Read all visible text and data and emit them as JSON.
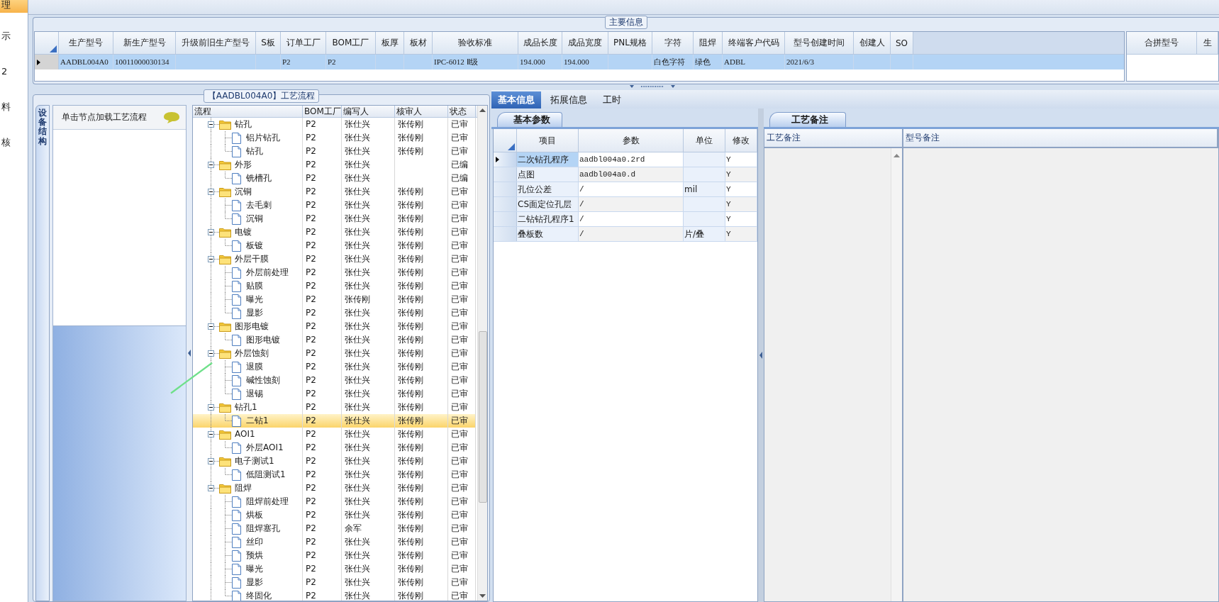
{
  "nav_strip": {
    "items": [
      {
        "label": "理",
        "selected": true
      },
      {
        "label": "示",
        "selected": false
      },
      {
        "label": "2",
        "selected": false
      },
      {
        "label": "料",
        "selected": false
      },
      {
        "label": "核",
        "selected": false
      }
    ]
  },
  "main_info": {
    "title": "主要信息",
    "columns": [
      "生产型号",
      "新生产型号",
      "升级前旧生产型号",
      "S板",
      "订单工厂",
      "BOM工厂",
      "板厚",
      "板材",
      "验收标准",
      "成品长度",
      "成品宽度",
      "PNL规格",
      "字符",
      "阻焊",
      "终端客户代码",
      "型号创建时间",
      "创建人",
      "SO"
    ],
    "rows": [
      {
        "selected": true,
        "cells": [
          "AADBL004A0",
          "10011000030134",
          null,
          null,
          "P2",
          "P2",
          null,
          null,
          "IPC-6012 Ⅱ级",
          "194.000",
          "194.000",
          null,
          "白色字符",
          "绿色",
          "ADBL",
          "2021/6/3",
          null,
          null
        ]
      }
    ]
  },
  "merge_table": {
    "columns": [
      "合拼型号",
      "生"
    ]
  },
  "process_flow": {
    "title": "【AADBL004A0】工艺流程",
    "side_tab": "设备结构",
    "hint": "单击节点加载工艺流程",
    "columns": [
      "流程",
      "BOM工厂",
      "编写人",
      "核审人",
      "状态"
    ],
    "tree": [
      {
        "name": "钻孔",
        "factory": "P2",
        "writer": "张仕兴",
        "reviewer": "张传刚",
        "status": "已审",
        "expanded": true,
        "selected": false,
        "children": [
          {
            "name": "铝片钻孔",
            "factory": "P2",
            "writer": "张仕兴",
            "reviewer": "张传刚",
            "status": "已审",
            "selected": false
          },
          {
            "name": "钻孔",
            "factory": "P2",
            "writer": "张仕兴",
            "reviewer": "张传刚",
            "status": "已审",
            "selected": false
          }
        ]
      },
      {
        "name": "外形",
        "factory": "P2",
        "writer": "张仕兴",
        "status": "已编",
        "expanded": true,
        "selected": false,
        "children": [
          {
            "name": "铣槽孔",
            "factory": "P2",
            "writer": "张仕兴",
            "status": "已编",
            "selected": false
          }
        ]
      },
      {
        "name": "沉铜",
        "factory": "P2",
        "writer": "张仕兴",
        "reviewer": "张传刚",
        "status": "已审",
        "expanded": true,
        "selected": false,
        "children": [
          {
            "name": "去毛刺",
            "factory": "P2",
            "writer": "张仕兴",
            "reviewer": "张传刚",
            "status": "已审",
            "selected": false
          },
          {
            "name": "沉铜",
            "factory": "P2",
            "writer": "张仕兴",
            "reviewer": "张传刚",
            "status": "已审",
            "selected": false
          }
        ]
      },
      {
        "name": "电镀",
        "factory": "P2",
        "writer": "张仕兴",
        "reviewer": "张传刚",
        "status": "已审",
        "expanded": true,
        "selected": false,
        "children": [
          {
            "name": "板镀",
            "factory": "P2",
            "writer": "张仕兴",
            "reviewer": "张传刚",
            "status": "已审",
            "selected": false
          }
        ]
      },
      {
        "name": "外层干膜",
        "factory": "P2",
        "writer": "张仕兴",
        "reviewer": "张传刚",
        "status": "已审",
        "expanded": true,
        "selected": false,
        "children": [
          {
            "name": "外层前处理",
            "factory": "P2",
            "writer": "张仕兴",
            "reviewer": "张传刚",
            "status": "已审",
            "selected": false
          },
          {
            "name": "贴膜",
            "factory": "P2",
            "writer": "张仕兴",
            "reviewer": "张传刚",
            "status": "已审",
            "selected": false
          },
          {
            "name": "曝光",
            "factory": "P2",
            "writer": "张传刚",
            "reviewer": "张传刚",
            "status": "已审",
            "selected": false
          },
          {
            "name": "显影",
            "factory": "P2",
            "writer": "张仕兴",
            "reviewer": "张传刚",
            "status": "已审",
            "selected": false
          }
        ]
      },
      {
        "name": "图形电镀",
        "factory": "P2",
        "writer": "张仕兴",
        "reviewer": "张传刚",
        "status": "已审",
        "expanded": true,
        "selected": false,
        "children": [
          {
            "name": "图形电镀",
            "factory": "P2",
            "writer": "张仕兴",
            "reviewer": "张传刚",
            "status": "已审",
            "selected": false
          }
        ]
      },
      {
        "name": "外层蚀刻",
        "factory": "P2",
        "writer": "张仕兴",
        "reviewer": "张传刚",
        "status": "已审",
        "expanded": true,
        "selected": false,
        "children": [
          {
            "name": "退膜",
            "factory": "P2",
            "writer": "张仕兴",
            "reviewer": "张传刚",
            "status": "已审",
            "selected": false
          },
          {
            "name": "碱性蚀刻",
            "factory": "P2",
            "writer": "张仕兴",
            "reviewer": "张传刚",
            "status": "已审",
            "selected": false
          },
          {
            "name": "退锡",
            "factory": "P2",
            "writer": "张仕兴",
            "reviewer": "张传刚",
            "status": "已审",
            "selected": false
          }
        ]
      },
      {
        "name": "钻孔1",
        "factory": "P2",
        "writer": "张仕兴",
        "reviewer": "张传刚",
        "status": "已审",
        "expanded": true,
        "selected": false,
        "children": [
          {
            "name": "二钻1",
            "factory": "P2",
            "writer": "张仕兴",
            "reviewer": "张传刚",
            "status": "已审",
            "selected": true
          }
        ]
      },
      {
        "name": "AOI1",
        "factory": "P2",
        "writer": "张仕兴",
        "reviewer": "张传刚",
        "status": "已审",
        "expanded": true,
        "selected": false,
        "children": [
          {
            "name": "外层AOI1",
            "factory": "P2",
            "writer": "张仕兴",
            "reviewer": "张传刚",
            "status": "已审",
            "selected": false
          }
        ]
      },
      {
        "name": "电子测试1",
        "factory": "P2",
        "writer": "张仕兴",
        "reviewer": "张传刚",
        "status": "已审",
        "expanded": true,
        "selected": false,
        "children": [
          {
            "name": "低阻测试1",
            "factory": "P2",
            "writer": "张仕兴",
            "reviewer": "张传刚",
            "status": "已审",
            "selected": false
          }
        ]
      },
      {
        "name": "阻焊",
        "factory": "P2",
        "writer": "张仕兴",
        "reviewer": "张传刚",
        "status": "已审",
        "expanded": true,
        "selected": false,
        "children": [
          {
            "name": "阻焊前处理",
            "factory": "P2",
            "writer": "张仕兴",
            "reviewer": "张传刚",
            "status": "已审",
            "selected": false
          },
          {
            "name": "烘板",
            "factory": "P2",
            "writer": "张仕兴",
            "reviewer": "张传刚",
            "status": "已审",
            "selected": false
          },
          {
            "name": "阻焊塞孔",
            "factory": "P2",
            "writer": "余军",
            "reviewer": "张传刚",
            "status": "已审",
            "selected": false
          },
          {
            "name": "丝印",
            "factory": "P2",
            "writer": "张仕兴",
            "reviewer": "张传刚",
            "status": "已审",
            "selected": false
          },
          {
            "name": "预烘",
            "factory": "P2",
            "writer": "张仕兴",
            "reviewer": "张传刚",
            "status": "已审",
            "selected": false
          },
          {
            "name": "曝光",
            "factory": "P2",
            "writer": "张仕兴",
            "reviewer": "张传刚",
            "status": "已审",
            "selected": false
          },
          {
            "name": "显影",
            "factory": "P2",
            "writer": "张仕兴",
            "reviewer": "张传刚",
            "status": "已审",
            "selected": false
          },
          {
            "name": "终固化",
            "factory": "P2",
            "writer": "张仕兴",
            "reviewer": "张传刚",
            "status": "已审",
            "selected": false
          }
        ]
      }
    ]
  },
  "detail_tabs": [
    {
      "label": "基本信息",
      "selected": true
    },
    {
      "label": "拓展信息",
      "selected": false
    },
    {
      "label": "工时",
      "selected": false
    }
  ],
  "basic_params": {
    "title": "基本参数",
    "columns": [
      "项目",
      "参数",
      "单位",
      "修改"
    ],
    "rows": [
      {
        "selected": true,
        "cells": [
          "二次钻孔程序",
          "aadbl004a0.2rd",
          null,
          "Y"
        ]
      },
      {
        "selected": false,
        "cells": [
          "点图",
          "aadbl004a0.d",
          null,
          "Y"
        ]
      },
      {
        "selected": false,
        "cells": [
          "孔位公差",
          "/",
          "mil",
          "Y"
        ]
      },
      {
        "selected": false,
        "cells": [
          "CS面定位孔层",
          "/",
          null,
          "Y"
        ]
      },
      {
        "selected": false,
        "cells": [
          "二钻钻孔程序1",
          "/",
          null,
          "Y"
        ]
      },
      {
        "selected": false,
        "cells": [
          "叠板数",
          "/",
          "片/叠",
          "Y"
        ]
      }
    ]
  },
  "process_notes": {
    "title": "工艺备注",
    "columns": [
      "工艺备注",
      "型号备注"
    ]
  }
}
